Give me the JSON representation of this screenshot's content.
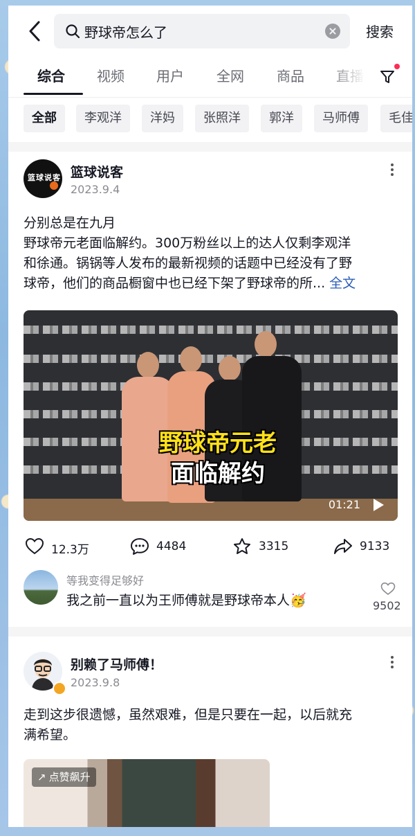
{
  "search": {
    "query": "野球帝怎么了",
    "button_label": "搜索"
  },
  "tabs": [
    {
      "label": "综合",
      "active": true
    },
    {
      "label": "视频"
    },
    {
      "label": "用户"
    },
    {
      "label": "全网"
    },
    {
      "label": "商品"
    },
    {
      "label": "直播"
    }
  ],
  "chips": [
    "全部",
    "李观洋",
    "洋妈",
    "张照洋",
    "郭洋",
    "马师傅",
    "毛佳"
  ],
  "post1": {
    "author": "篮球说客",
    "avatar_text": "篮球说客",
    "date": "2023.9.4",
    "text_line1": "分别总是在九月",
    "text_line2": "野球帝元老面临解约。300万粉丝以上的达人仅剩李观洋",
    "text_line3": "和徐通。锅锅等人发布的最新视频的话题中已经没有了野",
    "text_line4": "球帝，他们的商品橱窗中也已经下架了野球帝的所...",
    "more_link": "全文",
    "video": {
      "overlay_line1": "野球帝元老",
      "overlay_line2": "面临解约",
      "duration": "01:21"
    },
    "actions": {
      "likes": "12.3万",
      "comments": "4484",
      "favorites": "3315",
      "shares": "9133"
    },
    "top_comment": {
      "user": "等我变得足够好",
      "text": "我之前一直以为王师傅就是野球帝本人🥳",
      "likes": "9502"
    }
  },
  "post2": {
    "author": "别赖了马师傅！",
    "date": "2023.9.8",
    "text_line1": "走到这步很遗憾，虽然艰难，但是只要在一起，以后就充",
    "text_line2": "满希望。",
    "badge": "点赞飙升"
  },
  "colors": {
    "text": "#161823",
    "muted": "#8a8b91",
    "link": "#2b5cb5",
    "accent": "#fe2c55",
    "caption_yellow": "#ffe11a"
  }
}
